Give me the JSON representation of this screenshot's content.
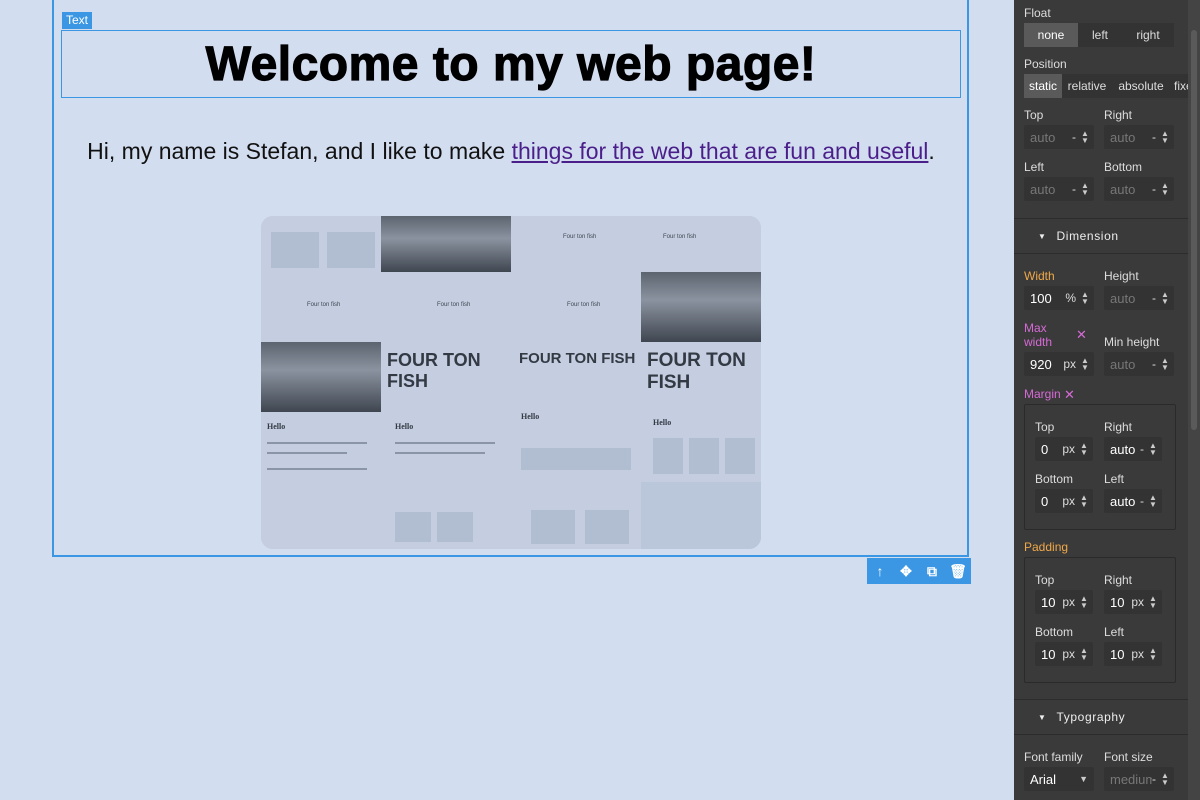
{
  "canvas": {
    "badge": "Text",
    "heading": "Welcome to my web page!",
    "intro_prefix": "Hi, my name is Stefan, and I like to make ",
    "intro_link": "things for the web that are fun and useful",
    "intro_suffix": ".",
    "collage": {
      "brand_big": "FOUR TON FISH",
      "hello": "Hello",
      "brand_small": "Four ton fish"
    }
  },
  "toolbar": {
    "icons": [
      "arrow-up-icon",
      "move-icon",
      "copy-icon",
      "delete-icon"
    ],
    "glyphs": [
      "↑",
      "✥",
      "⧉",
      "🗑"
    ]
  },
  "panel": {
    "float": {
      "label": "Float",
      "options": [
        "none",
        "left",
        "right"
      ],
      "selected": "none"
    },
    "position": {
      "label": "Position",
      "options": [
        "static",
        "relative",
        "absolute",
        "fixed"
      ],
      "selected": "static"
    },
    "offsets": {
      "top_label": "Top",
      "right_label": "Right",
      "left_label": "Left",
      "bottom_label": "Bottom",
      "placeholder": "auto",
      "unit": "-"
    },
    "dimension": {
      "header": "Dimension",
      "width_label": "Width",
      "width_value": "100",
      "width_unit": "%",
      "height_label": "Height",
      "height_placeholder": "auto",
      "height_unit": "-",
      "maxwidth_label": "Max width",
      "maxwidth_value": "920",
      "maxwidth_unit": "px",
      "minheight_label": "Min height",
      "minheight_placeholder": "auto",
      "minheight_unit": "-",
      "clear_glyph": "✕"
    },
    "margin": {
      "label": "Margin",
      "top_label": "Top",
      "top_value": "0",
      "top_unit": "px",
      "right_label": "Right",
      "right_value": "auto",
      "right_unit": "-",
      "bottom_label": "Bottom",
      "bottom_value": "0",
      "bottom_unit": "px",
      "left_label": "Left",
      "left_value": "auto",
      "left_unit": "-"
    },
    "padding": {
      "label": "Padding",
      "top_label": "Top",
      "top_value": "10",
      "top_unit": "px",
      "right_label": "Right",
      "right_value": "10",
      "right_unit": "px",
      "bottom_label": "Bottom",
      "bottom_value": "10",
      "bottom_unit": "px",
      "left_label": "Left",
      "left_value": "10",
      "left_unit": "px"
    },
    "typography": {
      "header": "Typography",
      "family_label": "Font family",
      "family_value": "Arial",
      "size_label": "Font size",
      "size_placeholder": "medium",
      "size_unit": "-"
    }
  },
  "colors": {
    "selection": "#3b97e3",
    "canvas_bg": "#d3ddf0",
    "panel_bg": "#3a3a3a",
    "orange_label": "#f0a848",
    "pink_label": "#d66ad6",
    "link": "#4b1f8a"
  }
}
